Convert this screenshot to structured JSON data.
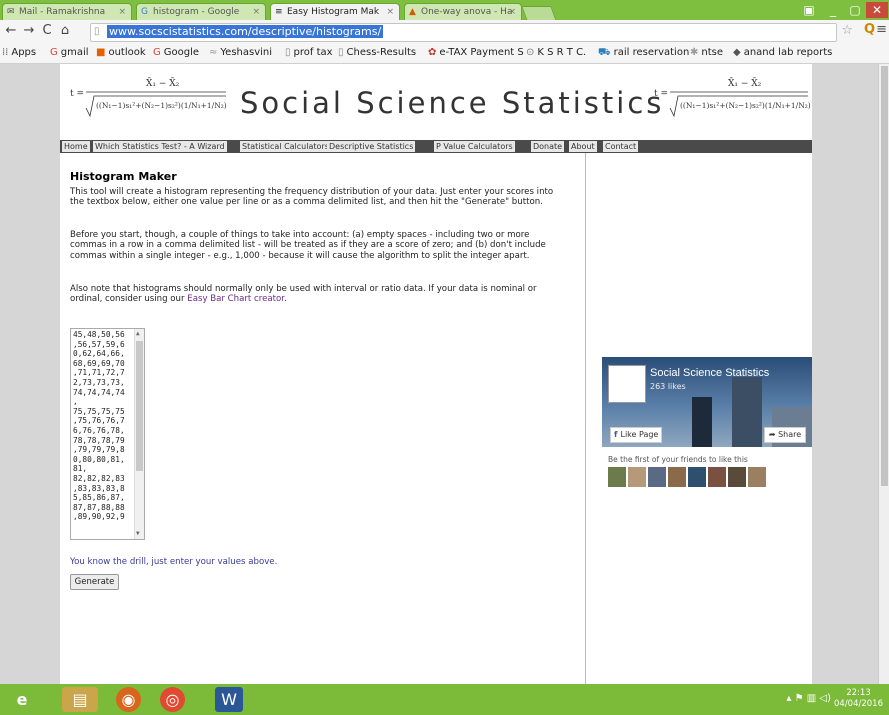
{
  "browser": {
    "tabs": [
      {
        "label": "Mail - Ramakrishna",
        "icon": "mail-icon"
      },
      {
        "label": "histogram - Google",
        "icon": "google-icon"
      },
      {
        "label": "Easy Histogram Mak",
        "icon": "page-icon"
      },
      {
        "label": "One-way anova - Ha",
        "icon": "chart-icon"
      }
    ],
    "url": "www.socscistatistics.com/descriptive/histograms/",
    "bookmarks": [
      "Apps",
      "gmail",
      "outlook",
      "Google",
      "Yeshasvini",
      "prof tax",
      "Chess-Results",
      "e-TAX Payment S",
      "K S R T C.",
      "rail reservation",
      "ntse",
      "anand lab reports"
    ]
  },
  "site": {
    "logo": "Social Science Statistics",
    "nav": [
      "Home",
      "Which Statistics Test? - A Wizard",
      "Statistical Calculators",
      "Descriptive Statistics",
      "P Value Calculators",
      "Donate",
      "About",
      "Contact"
    ]
  },
  "main": {
    "title": "Histogram Maker",
    "para1": "This tool will create a histogram representing the frequency distribution of your data. Just enter your scores into the textbox below, either one value per line or as a comma delimited list, and then hit the \"Generate\" button.",
    "para2": "Before you start, though, a couple of things to take into account: (a) empty spaces - including two or more commas in a row in a comma delimited list - will be treated as if they are a score of zero; and (b) don't include commas within a single integer - e.g., 1,000 - because it will cause the algorithm to split the integer apart.",
    "para3_pre": "Also note that histograms should normally only be used with interval or ratio data. If your data is nominal or ordinal, consider using our ",
    "para3_link": "Easy Bar Chart creator",
    "para3_post": ".",
    "textarea_lines": [
      "45,48,50,56",
      ",56,57,59,6",
      "0,62,64,66,",
      "68,69,69,70",
      ",71,71,72,7",
      "2,73,73,73,",
      "74,74,74,74",
      ",",
      "75,75,75,75",
      ",75,76,76,7",
      "6,76,76,78,",
      "78,78,78,79",
      ",79,79,79,8",
      "0,80,80,81,",
      "81,",
      "82,82,82,83",
      ",83,83,83,8",
      "5,85,86,87,",
      "87,87,88,88",
      ",89,90,92,9"
    ],
    "hint": "You know the drill, just enter your values above.",
    "generate": "Generate"
  },
  "facebook": {
    "page_name": "Social Science Statistics",
    "likes": "263 likes",
    "like_btn": "Like Page",
    "share_btn": "Share",
    "friends_text": "Be the first of your friends to like this"
  },
  "taskbar": {
    "time": "22:13",
    "date": "04/04/2016"
  }
}
